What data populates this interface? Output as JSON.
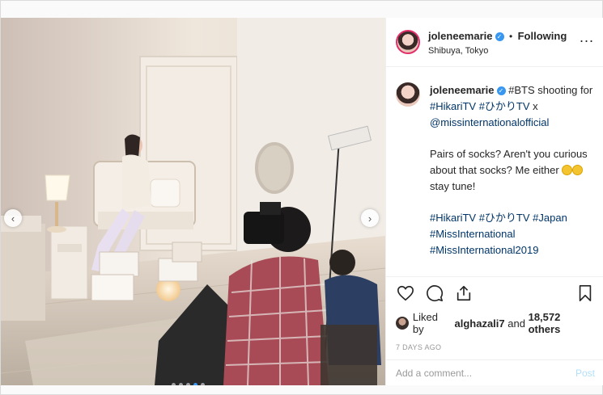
{
  "post": {
    "username": "joleneemarie",
    "separator": "•",
    "follow_status": "Following",
    "location": "Shibuya, Tokyo",
    "more_label": "..."
  },
  "caption": {
    "username": "joleneemarie",
    "line1_text": "#BTS shooting for",
    "line1_tag": "#HikariTV",
    "line1b_tag": "#ひかりTV",
    "line1b_text": " x",
    "mention": "@missinternationalofficial",
    "para2": "Pairs of socks? Aren't you curious about that socks? Me either",
    "para2_end": "stay tune!",
    "tags": [
      "#HikariTV",
      "#ひかりTV",
      "#Japan",
      "#MissInternational",
      "#MissInternational2019"
    ]
  },
  "likes": {
    "prefix": "Liked by",
    "user": "alghazali7",
    "middle": "and",
    "count": "18,572 others"
  },
  "date": "7 DAYS AGO",
  "comment_input": {
    "placeholder": "Add a comment...",
    "value": ""
  },
  "post_button": "Post",
  "carousel": {
    "prev": "‹",
    "next": "›",
    "slides": 5,
    "active_index": 3
  },
  "colors": {
    "accent": "#3897f0",
    "text": "#262626",
    "muted": "#999999",
    "post_disabled": "#b2dffc"
  },
  "icons": [
    "heart-icon",
    "comment-icon",
    "share-icon",
    "bookmark-icon",
    "verified-icon"
  ]
}
